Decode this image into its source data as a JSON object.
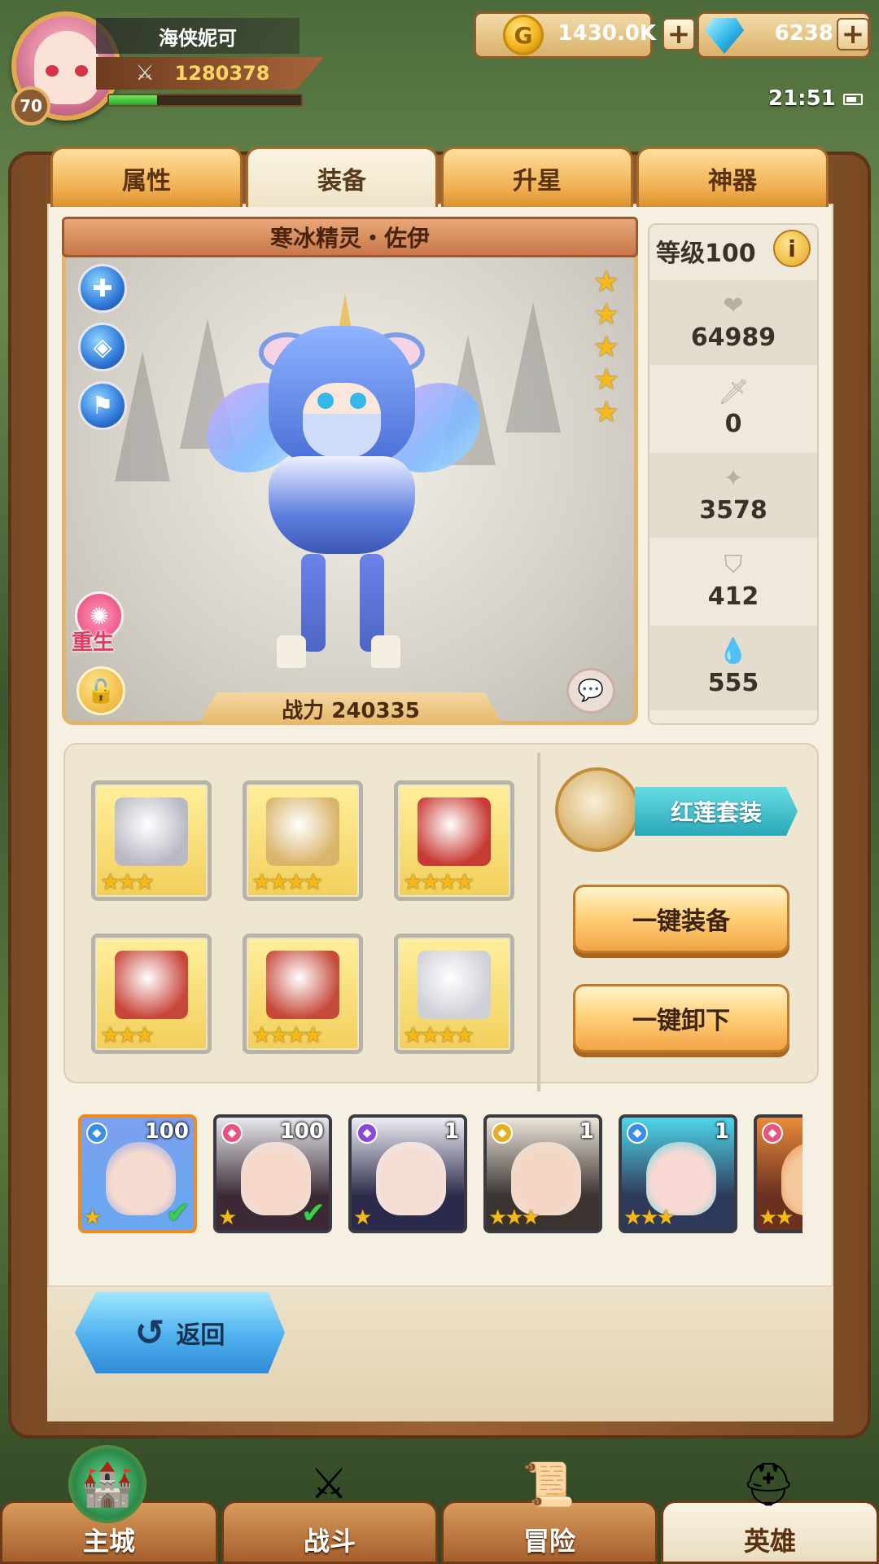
{
  "player": {
    "name": "海侠妮可",
    "level": "70",
    "power": "1280378",
    "exp_fraction": 0.25
  },
  "resources": {
    "gold": "1430.0K",
    "gems": "6238"
  },
  "status": {
    "time": "21:51"
  },
  "tabs": [
    {
      "label": "属性",
      "active": false
    },
    {
      "label": "装备",
      "active": true
    },
    {
      "label": "升星",
      "active": false
    },
    {
      "label": "神器",
      "active": false
    }
  ],
  "hero": {
    "name": "寒冰精灵・佐伊",
    "stars": 5,
    "combat_label": "战力 240335",
    "rebirth_label": "重生"
  },
  "stats": {
    "level_label": "等级100",
    "items": [
      {
        "icon": "heart-icon",
        "value": "64989"
      },
      {
        "icon": "sword-icon",
        "value": "0"
      },
      {
        "icon": "magic-icon",
        "value": "3578"
      },
      {
        "icon": "shield-icon",
        "value": "412"
      },
      {
        "icon": "drop-icon",
        "value": "555"
      }
    ]
  },
  "equipment": {
    "slots": [
      {
        "name": "helmet",
        "stars": 3,
        "color": "#b9b9c4"
      },
      {
        "name": "weapon",
        "stars": 4,
        "color": "#d9b46a"
      },
      {
        "name": "armor",
        "stars": 4,
        "color": "#c83a34"
      },
      {
        "name": "gloves",
        "stars": 3,
        "color": "#c8453a"
      },
      {
        "name": "boots",
        "stars": 4,
        "color": "#c64a3a"
      },
      {
        "name": "accessory",
        "stars": 4,
        "color": "#cfcfd8"
      }
    ],
    "set_name": "红莲套装",
    "equip_all_label": "一键装备",
    "unequip_all_label": "一键卸下"
  },
  "roster": [
    {
      "level": "100",
      "element": "blue",
      "bg": "#6aa7f0",
      "face": "#f6d9cf",
      "hair": "#7ea0ee",
      "stars": "★",
      "selected": true,
      "check": true
    },
    {
      "level": "100",
      "element": "pink",
      "bg": "#3b2a36",
      "face": "#f5d7c8",
      "hair": "#e8e8ec",
      "stars": "★",
      "selected": false,
      "check": true
    },
    {
      "level": "1",
      "element": "purple",
      "bg": "#2c2a4a",
      "face": "#f5dcd2",
      "hair": "#eeeef5",
      "stars": "★",
      "selected": false,
      "check": false
    },
    {
      "level": "1",
      "element": "gold",
      "bg": "#3a3330",
      "face": "#f3d6c4",
      "hair": "#ece6dc",
      "stars": "★★★",
      "selected": false,
      "check": false
    },
    {
      "level": "1",
      "element": "blue",
      "bg": "#2e3a5a",
      "face": "#f8d8d2",
      "hair": "#4fd6e8",
      "stars": "★★★",
      "selected": false,
      "check": false
    },
    {
      "level": "",
      "element": "pink",
      "bg": "#6a3020",
      "face": "#f3c89c",
      "hair": "#e88a3a",
      "stars": "★★",
      "selected": false,
      "check": false
    }
  ],
  "back_label": "返回",
  "nav": [
    {
      "label": "主城",
      "icon": "castle-icon",
      "active": false
    },
    {
      "label": "战斗",
      "icon": "swords-icon",
      "active": false
    },
    {
      "label": "冒险",
      "icon": "scroll-icon",
      "active": false
    },
    {
      "label": "英雄",
      "icon": "helmet-icon",
      "active": true
    }
  ],
  "colors": {
    "gold_text": "#ffd764",
    "tab_orange": "#f0ae4e",
    "set_teal": "#2aa7b8",
    "check_green": "#3ad04a"
  }
}
